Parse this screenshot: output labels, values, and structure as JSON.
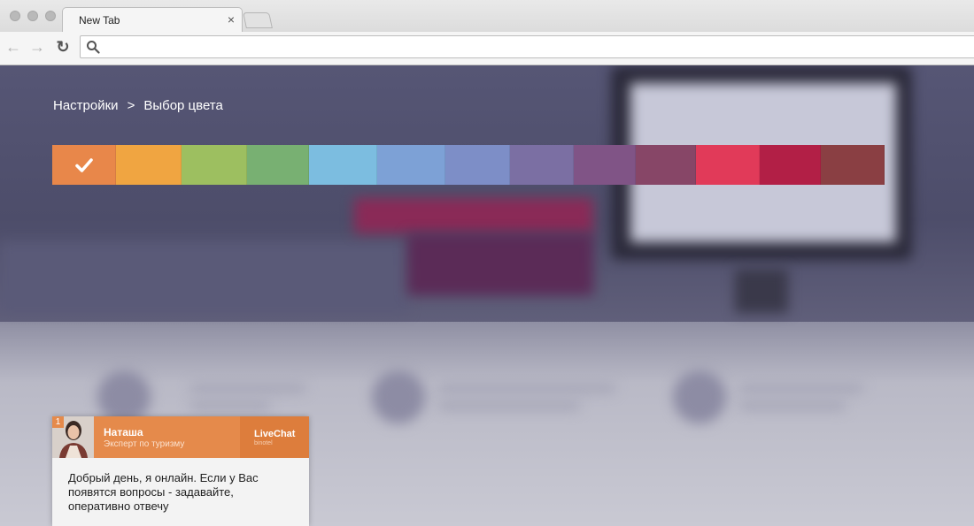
{
  "browser": {
    "tab_title": "New Tab",
    "tab_close": "×",
    "address_value": "",
    "back_glyph": "←",
    "forward_glyph": "→",
    "reload_glyph": "↻"
  },
  "breadcrumb": {
    "root": "Настройки",
    "separator": ">",
    "current": "Выбор цвета"
  },
  "color_picker": {
    "selected_index": 0,
    "swatches": [
      {
        "color": "#e8874a",
        "width": 72
      },
      {
        "color": "#f0a541",
        "width": 74
      },
      {
        "color": "#9dbf60",
        "width": 74
      },
      {
        "color": "#78b072",
        "width": 70
      },
      {
        "color": "#7cbde0",
        "width": 77
      },
      {
        "color": "#7da1d6",
        "width": 77
      },
      {
        "color": "#7d8ec7",
        "width": 73
      },
      {
        "color": "#7b6fa3",
        "width": 72
      },
      {
        "color": "#805486",
        "width": 70
      },
      {
        "color": "#874667",
        "width": 68
      },
      {
        "color": "#e13a59",
        "width": 72
      },
      {
        "color": "#b21f46",
        "width": 69
      },
      {
        "color": "#8a3f43",
        "width": 72
      }
    ]
  },
  "chat": {
    "unread_count": "1",
    "agent_name": "Наташа",
    "agent_role": "Эксперт по туризму",
    "brand_name": "LiveChat",
    "brand_sub": "binotel",
    "message": "Добрый день, я онлайн. Если у Вас появятся вопросы - задавайте, оперативно отвечу"
  },
  "colors": {
    "accent": "#e58a4b",
    "header_text": "#ffffff"
  },
  "icons": {
    "search": "search-icon",
    "check": "check-icon",
    "close": "close-icon"
  }
}
